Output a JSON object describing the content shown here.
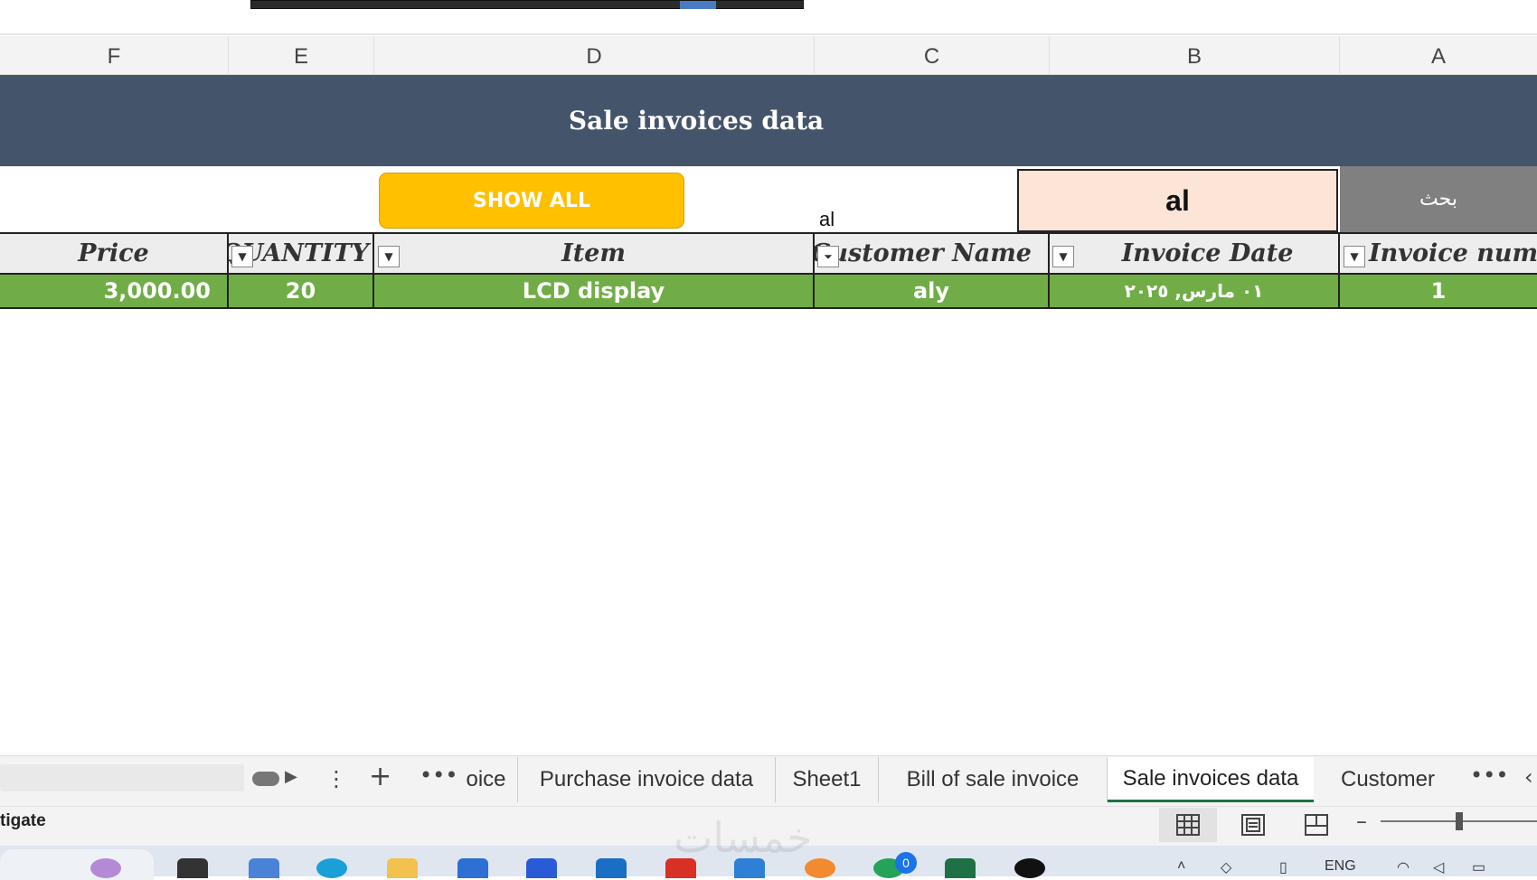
{
  "columns": [
    "F",
    "E",
    "D",
    "C",
    "B",
    "A"
  ],
  "banner": {
    "title": "Sale invoices data"
  },
  "search": {
    "show_all_label": "SHOW ALL",
    "small_text": "al",
    "value": "al",
    "label": "بحث"
  },
  "table": {
    "headers": {
      "price": "Price",
      "quantity": "QUANTITY",
      "item": "Item",
      "customer": "Customer Name",
      "date": "Invoice Date",
      "number": "Invoice number"
    },
    "rows": [
      {
        "price": "3,000.00",
        "quantity": "20",
        "item": "LCD display",
        "customer": "aly",
        "date": "٠١ مارس, ٢٠٢٥",
        "number": "1"
      }
    ],
    "row_color": "#70ad47",
    "header_color": "#ededed"
  },
  "sheets": {
    "tabs": [
      "oice",
      "Purchase invoice data",
      "Sheet1",
      "Bill of sale invoice",
      "Sale invoices data",
      "Customer"
    ],
    "active": "Sale invoices data"
  },
  "status": {
    "text": "tigate"
  },
  "taskbar": {
    "badge": "0",
    "language": "ENG",
    "watermark": "خمسات"
  },
  "colors": {
    "banner": "#44546a",
    "show_all": "#ffc000",
    "search_fill": "#fce4d6",
    "search_label": "#808080",
    "active_tab_underline": "#1e7145"
  }
}
